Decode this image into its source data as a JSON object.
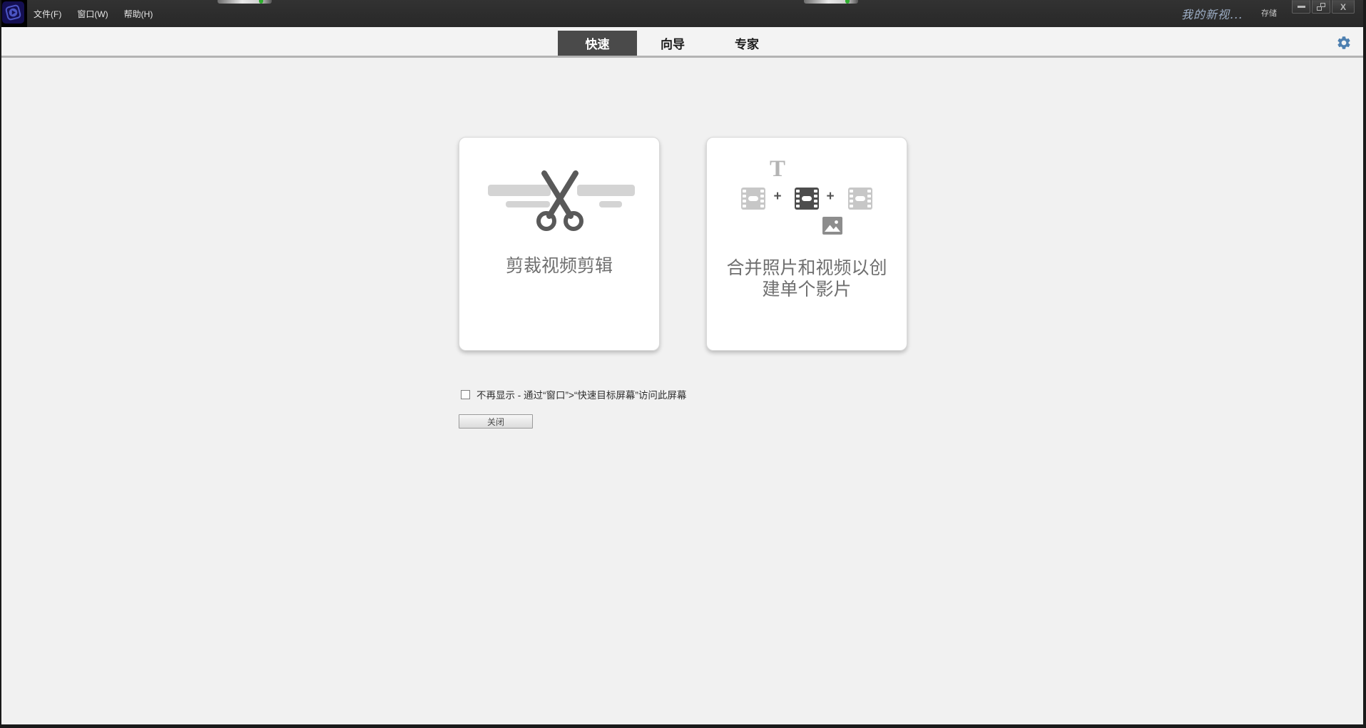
{
  "titlebar": {
    "menu_items": [
      {
        "label": "文件(F)"
      },
      {
        "label": "窗口(W)"
      },
      {
        "label": "帮助(H)"
      }
    ],
    "project_title": "我的新视...",
    "save_label": "存储",
    "close_glyph": "X"
  },
  "tabbar": {
    "tabs": [
      {
        "label": "快速",
        "selected": true
      },
      {
        "label": "向导",
        "selected": false
      },
      {
        "label": "专家",
        "selected": false
      }
    ]
  },
  "main": {
    "cards": [
      {
        "label": "剪裁视频剪辑"
      },
      {
        "label_line1": "合并照片和视频以创",
        "label_line2": "建单个影片",
        "text_icon": "T",
        "plus": "+"
      }
    ],
    "dont_show_label": "不再显示 - 通过“窗口”>“快速目标屏幕”访问此屏幕",
    "checkbox_checked": false,
    "close_button_label": "关闭"
  },
  "colors": {
    "accent_blue": "#4d7fb0",
    "selected_tab": "#4a4a4a",
    "menubar_bg": "#2b2b2b",
    "content_bg": "#f1f1f1",
    "card_bg": "#ffffff",
    "status_green": "#2fae2f"
  }
}
